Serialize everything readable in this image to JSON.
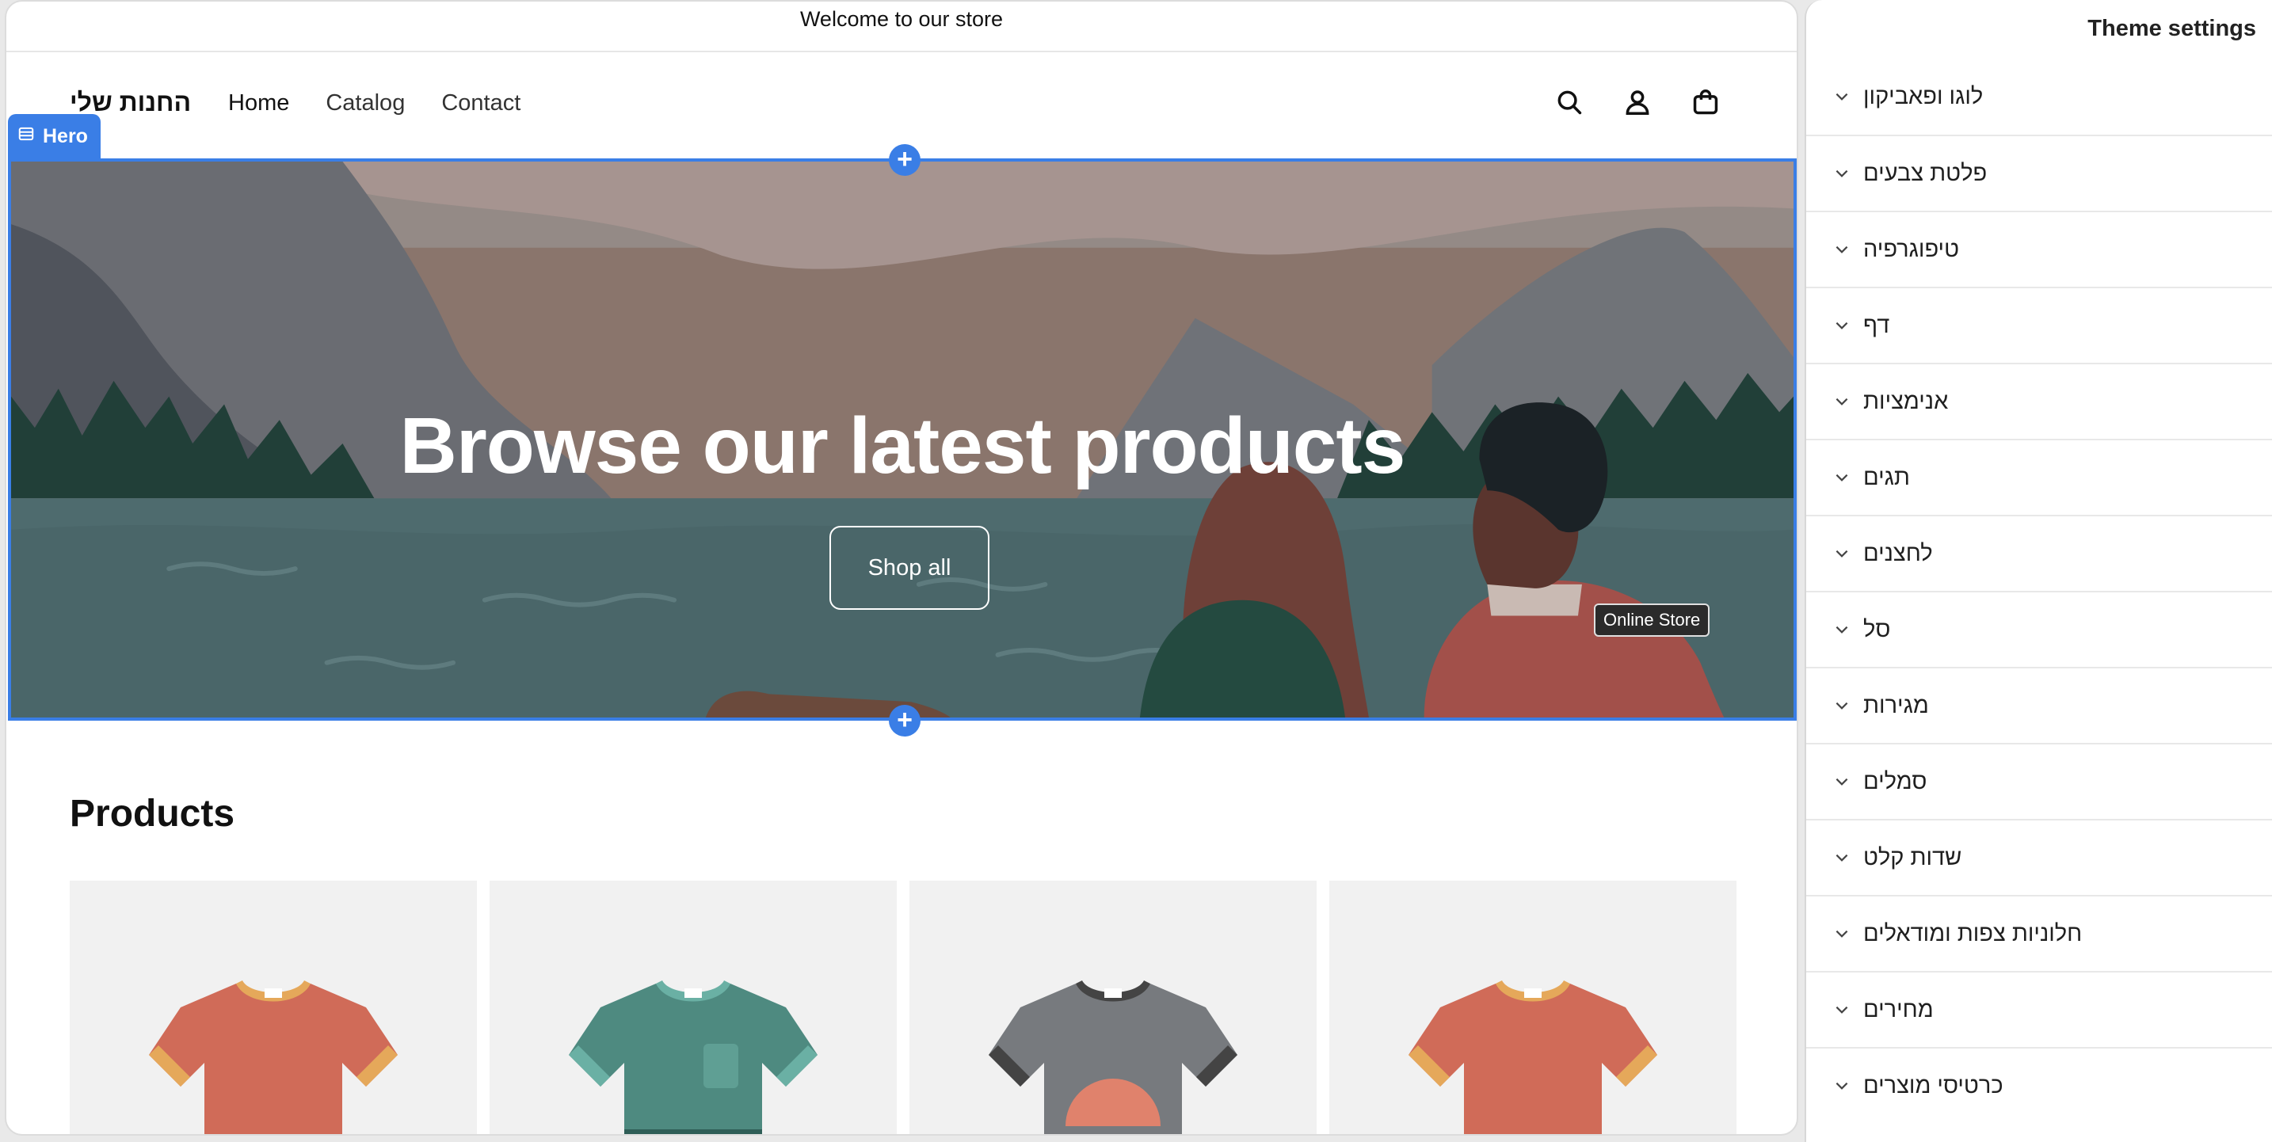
{
  "announcement": "Welcome to our store",
  "header": {
    "store_name": "החנות שלי",
    "nav": [
      "Home",
      "Catalog",
      "Contact"
    ],
    "icons": [
      "search-icon",
      "account-icon",
      "cart-icon"
    ]
  },
  "hero": {
    "section_label": "Hero",
    "title": "Browse our latest products",
    "button": "Shop all",
    "tooltip": "Online Store"
  },
  "products": {
    "title": "Products",
    "items": [
      {
        "color": "#d06b58",
        "collar": "#e5a85a"
      },
      {
        "color": "#4e8a80",
        "collar": "#6ab0a4"
      },
      {
        "color": "#777a7e",
        "collar": "#444444"
      },
      {
        "color": "#d06b58",
        "collar": "#e5a85a"
      }
    ]
  },
  "sidebar": {
    "title": "Theme settings",
    "items": [
      "לוגו ופאביקון",
      "פלטת צבעים",
      "טיפוגרפיה",
      "דף",
      "אנימציות",
      "תגים",
      "לחצנים",
      "סל",
      "מגירות",
      "סמלים",
      "שדות קלט",
      "חלוניות צפות ומודאלים",
      "מחירים",
      "כרטיסי מוצרים"
    ]
  },
  "colors": {
    "accent": "#3a7ee6"
  }
}
